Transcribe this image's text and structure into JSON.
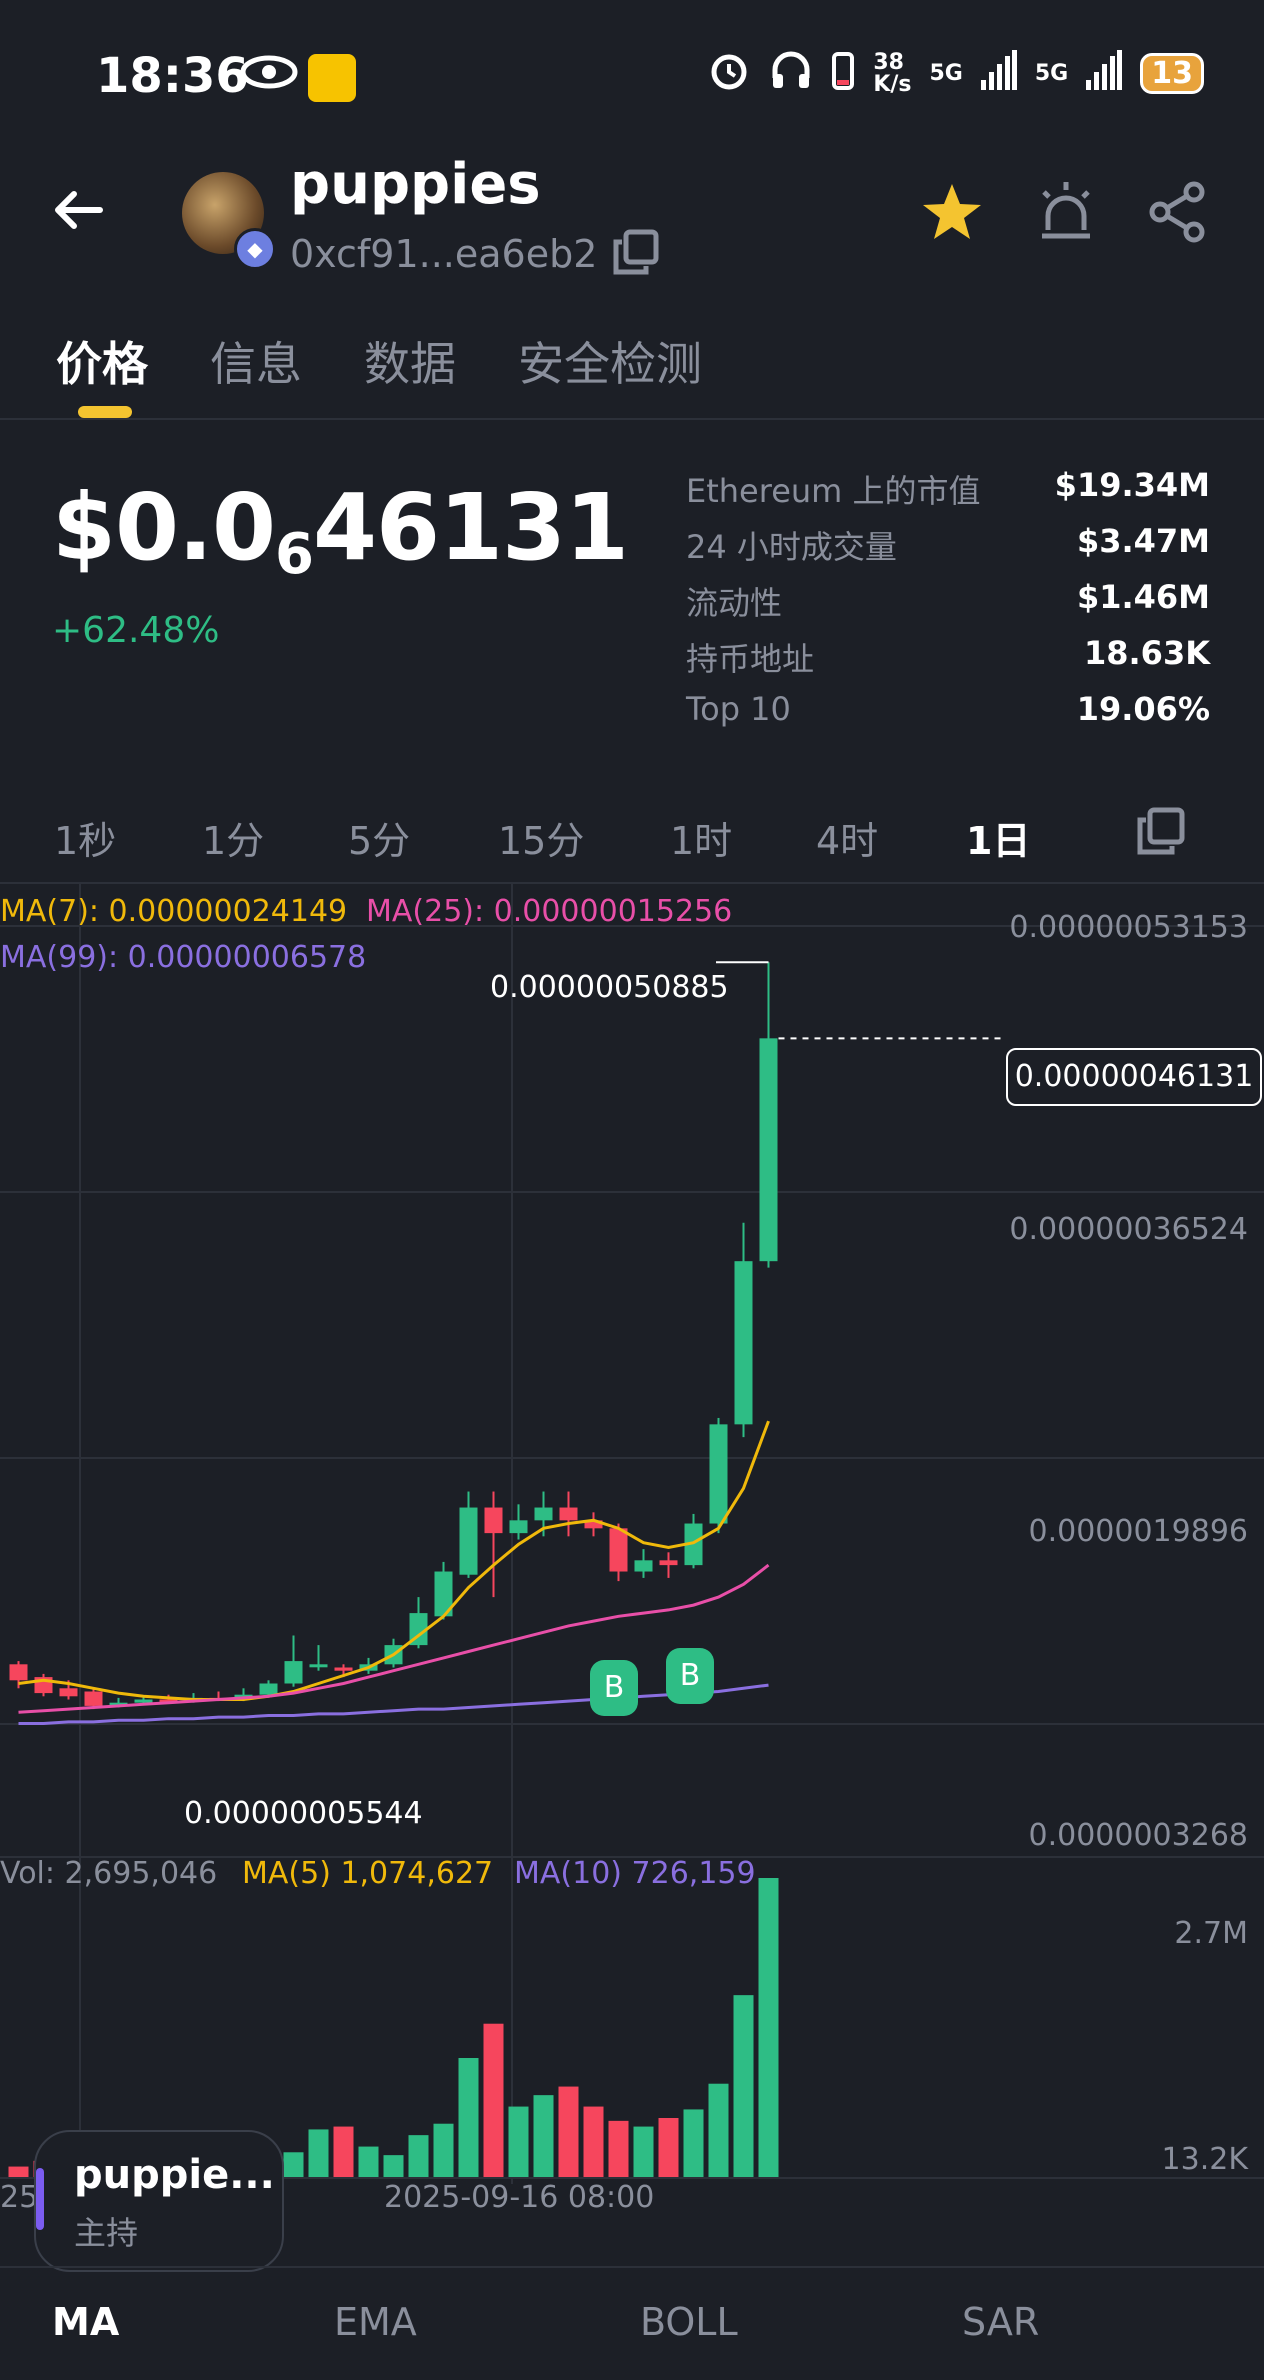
{
  "status_bar": {
    "time": "18:36",
    "net_speed": "38\nK/s",
    "net_speed_top": "38",
    "net_speed_bottom": "K/s",
    "sig1": "5G",
    "sig2": "5G",
    "battery": "13"
  },
  "header": {
    "token_name": "puppies",
    "address": "0xcf91...ea6eb2"
  },
  "tabs": [
    "价格",
    "信息",
    "数据",
    "安全检测"
  ],
  "price": {
    "prefix": "$0.0",
    "zeros": "6",
    "digits": "46131",
    "change": "+62.48%"
  },
  "stats": [
    {
      "label": "Ethereum 上的市值",
      "value": "$19.34M"
    },
    {
      "label": "24 小时成交量",
      "value": "$3.47M"
    },
    {
      "label": "流动性",
      "value": "$1.46M"
    },
    {
      "label": "持币地址",
      "value": "18.63K"
    },
    {
      "label": "Top 10",
      "value": "19.06%"
    }
  ],
  "intervals": [
    "1秒",
    "1分",
    "5分",
    "15分",
    "1时",
    "4时",
    "1日"
  ],
  "chart": {
    "ma7": "MA(7): 0.00000024149",
    "ma25": "MA(25): 0.00000015256",
    "ma99": "MA(99): 0.00000006578",
    "axis": [
      "0.00000053153",
      "0.00000036524",
      "0.0000019896",
      "0.0000003268"
    ],
    "high_label": "0.00000050885",
    "low_label": "0.00000005544",
    "current_price": "0.00000046131",
    "markers": [
      "B",
      "B"
    ],
    "vol_label": "Vol: 2,695,046",
    "vol_ma5": "MA(5) 1,074,627",
    "vol_ma10": "MA(10) 726,159",
    "vol_axis_top": "2.7M",
    "vol_axis_bottom": "13.2K",
    "date_label": "2025-09-16 08:00",
    "date_label_partial": "25-"
  },
  "float_card": {
    "title": "puppie...",
    "subtitle": "主持"
  },
  "indicators": [
    "MA",
    "EMA",
    "BOLL",
    "SAR"
  ],
  "colors": {
    "up": "#2ebd85",
    "down": "#f6465d",
    "ma7": "#f0b90b",
    "ma25": "#e84fa8",
    "ma99": "#8a6fe0",
    "accent": "#f4c430"
  },
  "chart_data": {
    "type": "candlestick",
    "ylim": [
      3.268e-08,
      5.3153e-07
    ],
    "series": [
      {
        "name": "MA(7)",
        "value": 2.4149e-07
      },
      {
        "name": "MA(25)",
        "value": 1.5256e-07
      },
      {
        "name": "MA(99)",
        "value": 6.578e-08
      }
    ],
    "candles": [
      {
        "o": 0.07,
        "c": 0.06,
        "h": 0.072,
        "l": 0.055
      },
      {
        "o": 0.062,
        "c": 0.052,
        "h": 0.064,
        "l": 0.05
      },
      {
        "o": 0.055,
        "c": 0.05,
        "h": 0.06,
        "l": 0.048
      },
      {
        "o": 0.053,
        "c": 0.044,
        "h": 0.055,
        "l": 0.042
      },
      {
        "o": 0.044,
        "c": 0.046,
        "h": 0.049,
        "l": 0.043
      },
      {
        "o": 0.046,
        "c": 0.048,
        "h": 0.05,
        "l": 0.045
      },
      {
        "o": 0.048,
        "c": 0.047,
        "h": 0.051,
        "l": 0.046
      },
      {
        "o": 0.047,
        "c": 0.049,
        "h": 0.052,
        "l": 0.046
      },
      {
        "o": 0.049,
        "c": 0.048,
        "h": 0.053,
        "l": 0.047
      },
      {
        "o": 0.048,
        "c": 0.051,
        "h": 0.055,
        "l": 0.047
      },
      {
        "o": 0.051,
        "c": 0.058,
        "h": 0.06,
        "l": 0.05
      },
      {
        "o": 0.058,
        "c": 0.072,
        "h": 0.088,
        "l": 0.056
      },
      {
        "o": 0.07,
        "c": 0.07,
        "h": 0.082,
        "l": 0.066
      },
      {
        "o": 0.068,
        "c": 0.066,
        "h": 0.07,
        "l": 0.062
      },
      {
        "o": 0.066,
        "c": 0.07,
        "h": 0.074,
        "l": 0.064
      },
      {
        "o": 0.07,
        "c": 0.082,
        "h": 0.086,
        "l": 0.068
      },
      {
        "o": 0.082,
        "c": 0.102,
        "h": 0.112,
        "l": 0.08
      },
      {
        "o": 0.1,
        "c": 0.128,
        "h": 0.134,
        "l": 0.098
      },
      {
        "o": 0.126,
        "c": 0.168,
        "h": 0.178,
        "l": 0.124
      },
      {
        "o": 0.168,
        "c": 0.152,
        "h": 0.178,
        "l": 0.112
      },
      {
        "o": 0.152,
        "c": 0.16,
        "h": 0.17,
        "l": 0.148
      },
      {
        "o": 0.16,
        "c": 0.168,
        "h": 0.178,
        "l": 0.15
      },
      {
        "o": 0.168,
        "c": 0.16,
        "h": 0.178,
        "l": 0.15
      },
      {
        "o": 0.16,
        "c": 0.155,
        "h": 0.165,
        "l": 0.15
      },
      {
        "o": 0.155,
        "c": 0.128,
        "h": 0.158,
        "l": 0.122
      },
      {
        "o": 0.128,
        "c": 0.135,
        "h": 0.142,
        "l": 0.124
      },
      {
        "o": 0.135,
        "c": 0.132,
        "h": 0.14,
        "l": 0.124
      },
      {
        "o": 0.132,
        "c": 0.158,
        "h": 0.164,
        "l": 0.13
      },
      {
        "o": 0.158,
        "c": 0.22,
        "h": 0.224,
        "l": 0.152
      },
      {
        "o": 0.22,
        "c": 0.322,
        "h": 0.346,
        "l": 0.212
      },
      {
        "o": 0.322,
        "c": 0.46131,
        "h": 0.50885,
        "l": 0.318
      }
    ],
    "ma7_line": [
      0.058,
      0.06,
      0.058,
      0.055,
      0.052,
      0.05,
      0.049,
      0.048,
      0.048,
      0.048,
      0.05,
      0.053,
      0.058,
      0.063,
      0.068,
      0.076,
      0.088,
      0.1,
      0.118,
      0.132,
      0.145,
      0.155,
      0.158,
      0.16,
      0.155,
      0.146,
      0.143,
      0.146,
      0.155,
      0.18,
      0.222
    ],
    "ma25_line": [
      0.04,
      0.041,
      0.042,
      0.043,
      0.044,
      0.045,
      0.046,
      0.047,
      0.048,
      0.049,
      0.05,
      0.052,
      0.055,
      0.058,
      0.062,
      0.066,
      0.07,
      0.074,
      0.078,
      0.082,
      0.086,
      0.09,
      0.094,
      0.097,
      0.1,
      0.102,
      0.104,
      0.107,
      0.112,
      0.12,
      0.132
    ],
    "ma99_line": [
      0.033,
      0.033,
      0.034,
      0.034,
      0.035,
      0.035,
      0.036,
      0.036,
      0.037,
      0.037,
      0.038,
      0.038,
      0.039,
      0.039,
      0.04,
      0.041,
      0.042,
      0.042,
      0.043,
      0.044,
      0.045,
      0.046,
      0.047,
      0.048,
      0.049,
      0.05,
      0.051,
      0.052,
      0.053,
      0.055,
      0.057
    ],
    "volumes": [
      40,
      60,
      30,
      30,
      20,
      20,
      20,
      20,
      30,
      60,
      60,
      90,
      170,
      180,
      110,
      80,
      150,
      190,
      420,
      540,
      250,
      290,
      320,
      250,
      200,
      180,
      210,
      240,
      330,
      640,
      1050
    ]
  }
}
